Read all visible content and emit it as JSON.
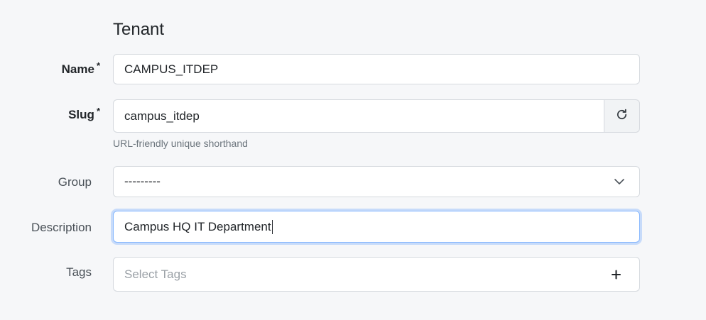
{
  "section": {
    "title": "Tenant"
  },
  "name": {
    "label": "Name",
    "required_mark": "*",
    "value": "CAMPUS_ITDEP"
  },
  "slug": {
    "label": "Slug",
    "required_mark": "*",
    "value": "campus_itdep",
    "help": "URL-friendly unique shorthand",
    "regenerate_icon": "refresh-icon"
  },
  "group": {
    "label": "Group",
    "value": "---------",
    "icon": "chevron-down-icon"
  },
  "description": {
    "label": "Description",
    "value": "Campus HQ IT Department"
  },
  "tags": {
    "label": "Tags",
    "placeholder": "Select Tags",
    "icon": "plus-icon"
  }
}
